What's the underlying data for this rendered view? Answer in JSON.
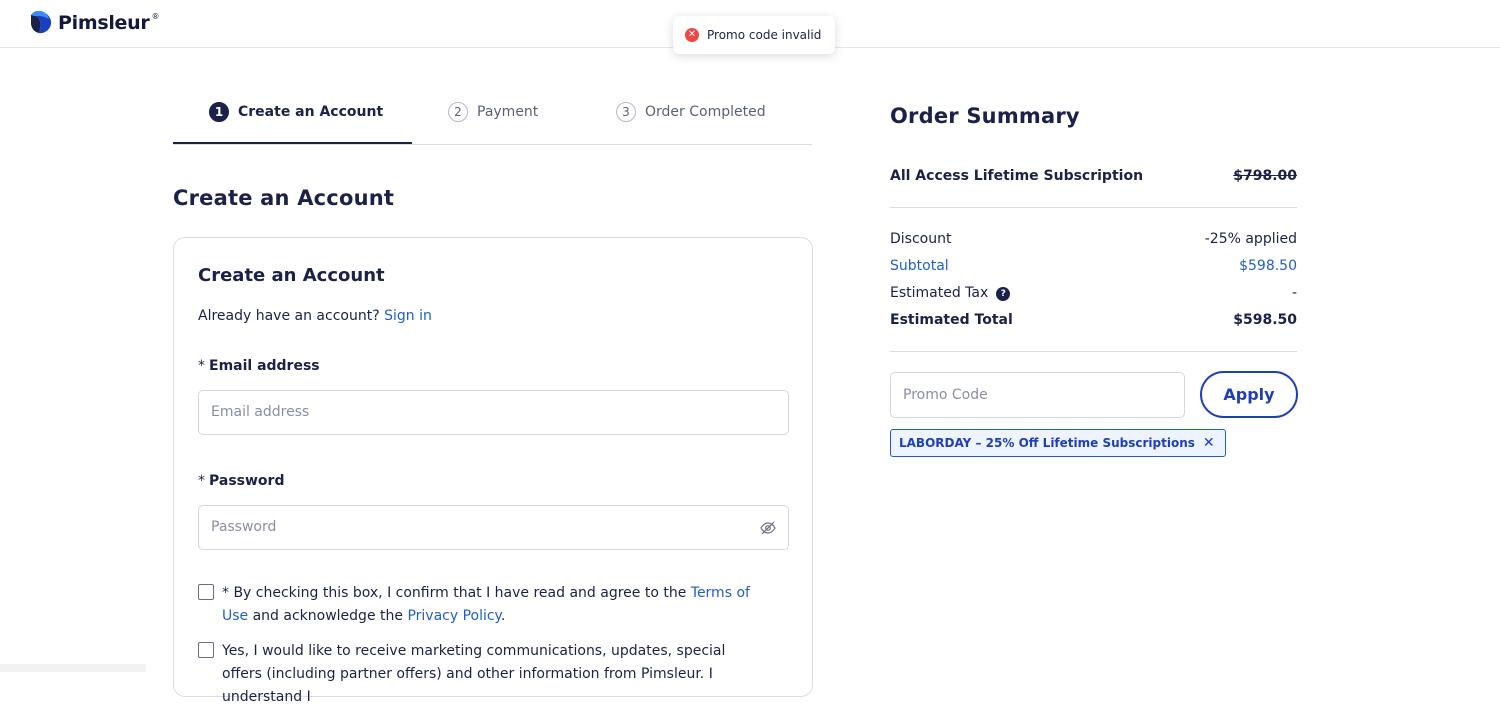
{
  "header": {
    "brand": "Pimsleur",
    "reg": "®"
  },
  "toast": {
    "message": "Promo code invalid"
  },
  "steps": [
    {
      "num": "1",
      "label": "Create an Account"
    },
    {
      "num": "2",
      "label": "Payment"
    },
    {
      "num": "3",
      "label": "Order Completed"
    }
  ],
  "main": {
    "section_title": "Create an Account",
    "card_title": "Create an Account",
    "signin_prompt": "Already have an account?",
    "signin_link": "Sign in",
    "email": {
      "required": "*",
      "label": "Email address",
      "placeholder": "Email address"
    },
    "password": {
      "required": "*",
      "label": "Password",
      "placeholder": "Password"
    },
    "terms": {
      "prefix": "* By checking this box, I confirm that I have read and agree to the ",
      "terms_link": "Terms of Use",
      "middle": " and acknowledge the ",
      "privacy_link": "Privacy Policy",
      "suffix": "."
    },
    "marketing": "Yes, I would like to receive marketing communications, updates, special offers (including partner offers) and other information from Pimsleur. I understand I"
  },
  "summary": {
    "title": "Order Summary",
    "product": {
      "name": "All Access Lifetime Subscription",
      "price": "$798.00"
    },
    "discount": {
      "label": "Discount",
      "value": "-25% applied"
    },
    "subtotal": {
      "label": "Subtotal",
      "value": "$598.50"
    },
    "tax": {
      "label": "Estimated Tax",
      "help": "?",
      "value": "-"
    },
    "total": {
      "label": "Estimated Total",
      "value": "$598.50"
    },
    "promo_placeholder": "Promo Code",
    "apply_label": "Apply",
    "applied_code": "LABORDAY – 25% Off Lifetime Subscriptions"
  }
}
